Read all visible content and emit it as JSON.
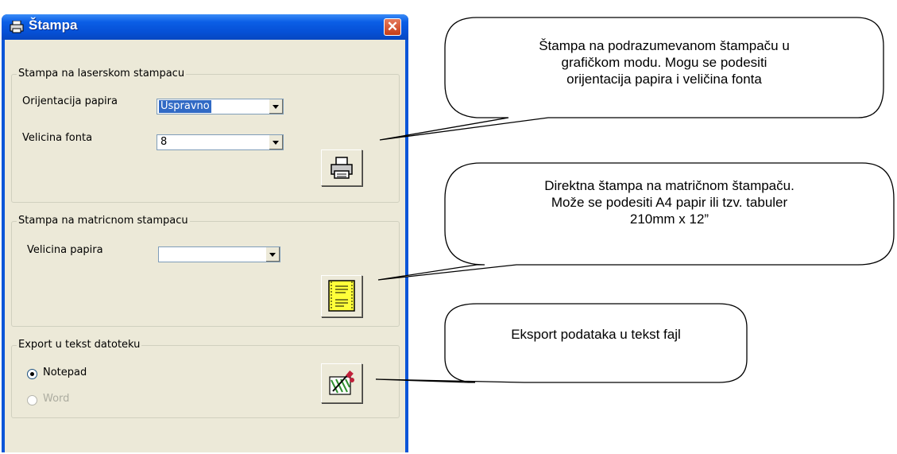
{
  "window": {
    "title": "Štampa",
    "close_label": "✕"
  },
  "laser": {
    "legend": "Stampa na laserskom stampacu",
    "orientation_label": "Orijentacija papira",
    "orientation_value": "Uspravno",
    "font_label": "Velicina fonta",
    "font_value": "8",
    "print_button_icon": "printer-icon"
  },
  "matrix": {
    "legend": "Stampa na matricnom stampacu",
    "paper_label": "Velicina papira",
    "paper_value": "",
    "print_button_icon": "document-icon"
  },
  "export": {
    "legend": "Export u tekst datoteku",
    "option_notepad": "Notepad",
    "option_word": "Word",
    "selected": "Notepad",
    "export_button_icon": "export-pen-icon"
  },
  "callouts": {
    "laser_lines": [
      "Štampa na podrazumevanom štampaču u",
      "grafičkom modu. Mogu se podesiti",
      "orijentacija papira i veličina fonta"
    ],
    "matrix_lines": [
      "Direktna štampa na matričnom štampaču.",
      "Može se podesiti A4 papir ili tzv. tabuler",
      "210mm x 12”"
    ],
    "export_lines": [
      "Eksport podataka u tekst fajl"
    ]
  }
}
